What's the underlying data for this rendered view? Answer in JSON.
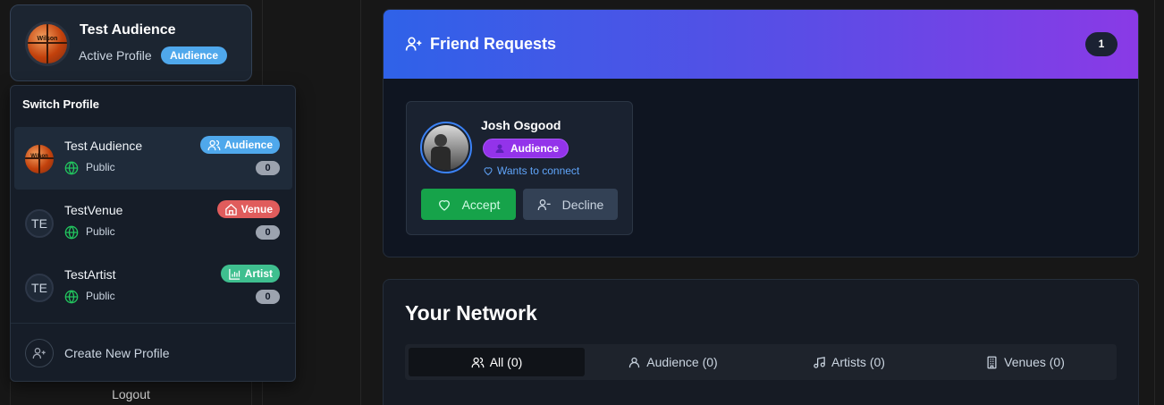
{
  "colors": {
    "audience": "#4fa8ec",
    "venue": "#e05c5c",
    "artist": "#3fbf8f",
    "accept": "#16a34a",
    "purple_badge": "#9333ea",
    "link": "#60a5fa"
  },
  "active_profile": {
    "name": "Test Audience",
    "subtitle": "Active Profile",
    "badge": "Audience",
    "avatar_text": "Wilson"
  },
  "switcher": {
    "title": "Switch Profile",
    "profiles": [
      {
        "name": "Test Audience",
        "type": "Audience",
        "type_icon": "users-icon",
        "visibility": "Public",
        "count": "0",
        "avatar": "basketball",
        "avatar_text": "Wilson",
        "selected": true
      },
      {
        "name": "TestVenue",
        "type": "Venue",
        "type_icon": "home-icon",
        "visibility": "Public",
        "count": "0",
        "avatar": "initials",
        "initials": "TE",
        "selected": false
      },
      {
        "name": "TestArtist",
        "type": "Artist",
        "type_icon": "bar-chart-icon",
        "visibility": "Public",
        "count": "0",
        "avatar": "initials",
        "initials": "TE",
        "selected": false
      }
    ],
    "create_label": "Create New Profile"
  },
  "logout_label": "Logout",
  "friend_requests": {
    "title": "Friend Requests",
    "count": "1",
    "requests": [
      {
        "name": "Josh Osgood",
        "badge": "Audience",
        "subtitle": "Wants to connect",
        "accept_label": "Accept",
        "decline_label": "Decline"
      }
    ]
  },
  "network": {
    "title": "Your Network",
    "tabs": [
      {
        "label": "All (0)",
        "icon": "users-icon",
        "active": true
      },
      {
        "label": "Audience (0)",
        "icon": "user-icon",
        "active": false
      },
      {
        "label": "Artists (0)",
        "icon": "music-icon",
        "active": false
      },
      {
        "label": "Venues (0)",
        "icon": "building-icon",
        "active": false
      }
    ]
  }
}
